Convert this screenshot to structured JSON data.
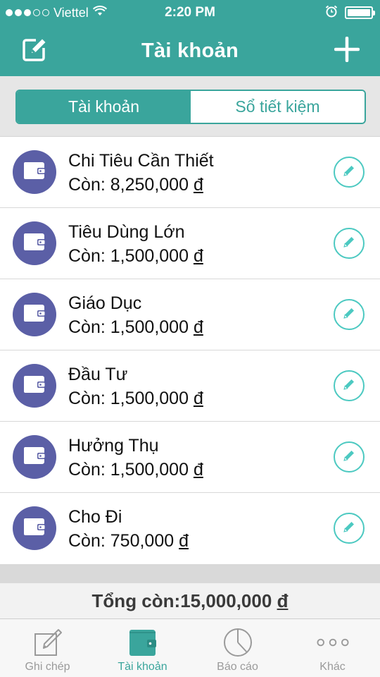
{
  "status_bar": {
    "carrier": "Viettel",
    "time": "2:20 PM"
  },
  "nav": {
    "title": "Tài khoản",
    "left_icon": "edit-note-icon",
    "right_icon": "plus-icon"
  },
  "segments": [
    {
      "label": "Tài khoản",
      "active": true
    },
    {
      "label": "Sổ tiết kiệm",
      "active": false
    }
  ],
  "accounts": [
    {
      "name": "Chi Tiêu Cần Thiết",
      "balance_prefix": "Còn: ",
      "amount": "8,250,000",
      "currency": "đ"
    },
    {
      "name": "Tiêu Dùng Lớn",
      "balance_prefix": "Còn: ",
      "amount": "1,500,000",
      "currency": "đ"
    },
    {
      "name": "Giáo Dục",
      "balance_prefix": "Còn: ",
      "amount": "1,500,000",
      "currency": "đ"
    },
    {
      "name": "Đầu Tư",
      "balance_prefix": "Còn: ",
      "amount": "1,500,000",
      "currency": "đ"
    },
    {
      "name": "Hưởng Thụ",
      "balance_prefix": "Còn: ",
      "amount": "1,500,000",
      "currency": "đ"
    },
    {
      "name": "Cho Đi",
      "balance_prefix": "Còn: ",
      "amount": "750,000",
      "currency": "đ"
    }
  ],
  "total": {
    "prefix": "Tổng còn: ",
    "amount": "15,000,000",
    "currency": "đ"
  },
  "tabs": [
    {
      "label": "Ghi chép",
      "icon": "note-pencil-icon",
      "active": false
    },
    {
      "label": "Tài khoản",
      "icon": "wallet-icon",
      "active": true
    },
    {
      "label": "Báo cáo",
      "icon": "pie-chart-icon",
      "active": false
    },
    {
      "label": "Khác",
      "icon": "more-dots-icon",
      "active": false
    }
  ],
  "colors": {
    "brand": "#3aa59c",
    "avatar": "#5b5fa6",
    "edit_ring": "#4cc9c1"
  }
}
